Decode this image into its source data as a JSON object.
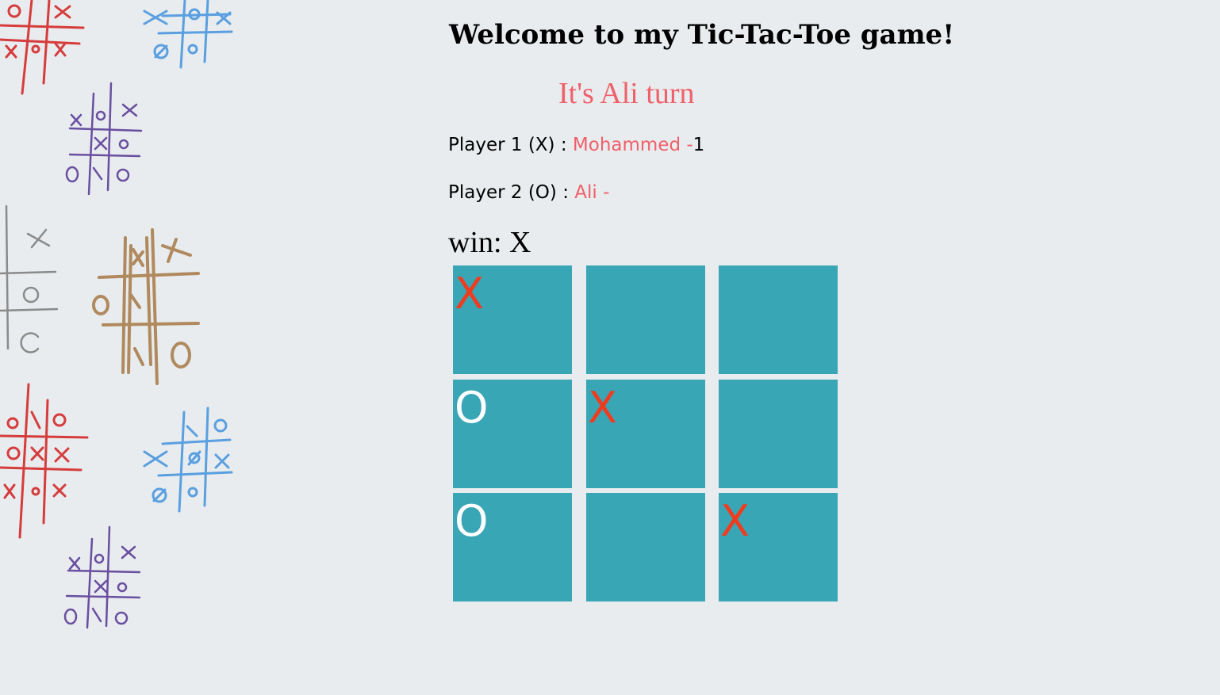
{
  "header": {
    "title": "Welcome to my Tic-Tac-Toe game!",
    "turn_text": "It's Ali turn"
  },
  "players": [
    {
      "label": "Player 1 (X) : ",
      "name": "Mohammed -",
      "score": "1"
    },
    {
      "label": "Player 2 (O) : ",
      "name": "Ali -",
      "score": ""
    }
  ],
  "status": {
    "win_text": "win: X"
  },
  "board": {
    "cells": [
      "X",
      "",
      "",
      "O",
      "X",
      "",
      "O",
      "",
      "X"
    ]
  },
  "colors": {
    "background": "#e8ecee",
    "cell": "#39a6b6",
    "x_mark": "#f03c1e",
    "o_mark": "#ffffff",
    "accent_text": "#f0606a"
  }
}
